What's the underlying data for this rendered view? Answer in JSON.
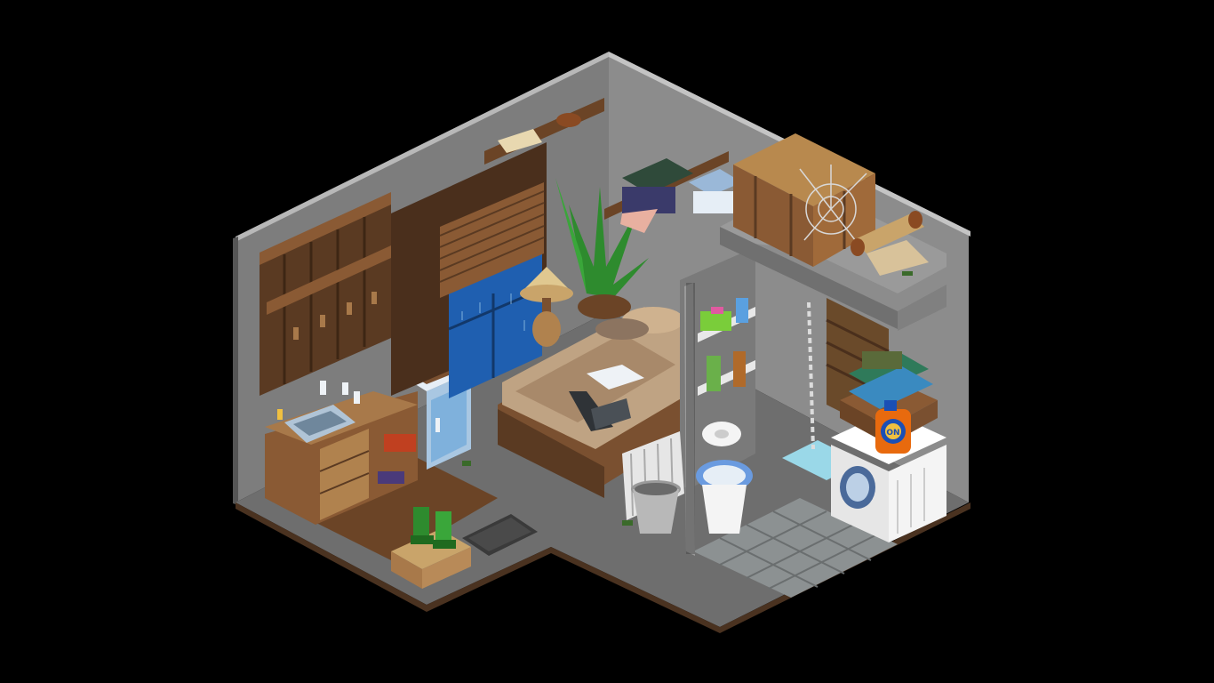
{
  "scene": {
    "type": "isometric pixel-art room",
    "background_color": "#000000"
  },
  "detergent": {
    "brand_text": "ON"
  },
  "palette": {
    "wall_left": "#7d7d7d",
    "wall_right": "#8a8a8a",
    "floor_gray": "#6e6e6e",
    "wood_dark": "#5a3a22",
    "wood_mid": "#7a5030",
    "wood_light": "#a8794a",
    "window_blue": "#1f5fb0",
    "bed_sheet": "#bfa383",
    "plant_green": "#2e8b2e",
    "tile_floor": "#8c9192",
    "appliance_white": "#f2f2f2",
    "detergent_orange": "#e86a0e",
    "detergent_blue": "#1a4fb5",
    "toilet_blue": "#6a9be0"
  },
  "objects": [
    "wooden-coat-rack",
    "wall-shelf",
    "sink-counter",
    "mini-fridge",
    "window-with-blinds",
    "table-lamp",
    "potted-palm",
    "bed",
    "laptop",
    "radiator",
    "trash-bucket",
    "bathroom-shelf",
    "toilet",
    "toilet-paper",
    "shower",
    "washing-machine",
    "laundry-basket",
    "detergent-bottle",
    "clothes-shelf",
    "wooden-chest",
    "spider-web",
    "scroll",
    "boots-crate",
    "door-mat"
  ]
}
